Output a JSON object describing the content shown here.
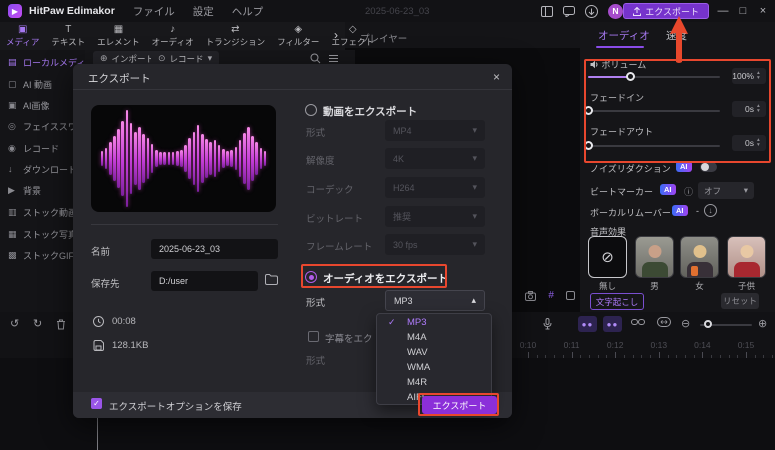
{
  "colors": {
    "accent": "#9a5cf0",
    "annotation": "#e8472e",
    "export_purple": "#8b2fd9",
    "waveform_pink": "#e85ad1"
  },
  "titlebar": {
    "app_name": "HitPaw Edimakor",
    "menus": [
      "ファイル",
      "設定",
      "ヘルプ"
    ],
    "project_name": "2025-06-23_03",
    "avatar": "N",
    "export_button": "エクスポート",
    "window": {
      "minimize": "—",
      "maximize": "□",
      "close": "×"
    }
  },
  "tabs": {
    "items": [
      {
        "label": "メディア",
        "icon": "▣"
      },
      {
        "label": "テキスト",
        "icon": "T"
      },
      {
        "label": "エレメント",
        "icon": "▦"
      },
      {
        "label": "オーディオ",
        "icon": "♪"
      },
      {
        "label": "トランジション",
        "icon": "⇄"
      },
      {
        "label": "フィルター",
        "icon": "◈"
      },
      {
        "label": "エフェクト",
        "icon": "◇"
      }
    ],
    "more": "›"
  },
  "player": {
    "label": "プレイヤー",
    "chevron": "⌄",
    "grid": "#"
  },
  "media_toolbar": {
    "import_icon": "⊕",
    "import": "インポート",
    "record_icon": "⊙",
    "record": "レコード",
    "dropdown": "▾"
  },
  "sidebar": {
    "items": [
      {
        "icon": "▤",
        "label": "ローカルメディア"
      },
      {
        "icon": "▢",
        "label": "AI 動画"
      },
      {
        "icon": "▣",
        "label": "AI画像"
      },
      {
        "icon": "◎",
        "label": "フェイススワップ"
      },
      {
        "icon": "◉",
        "label": "レコード"
      },
      {
        "icon": "↓",
        "label": "ダウンロード"
      },
      {
        "icon": "▶",
        "label": "背景"
      },
      {
        "icon": "▥",
        "label": "ストック動画"
      },
      {
        "icon": "▦",
        "label": "ストック写真"
      },
      {
        "icon": "▩",
        "label": "ストックGIF"
      }
    ]
  },
  "dialog": {
    "title": "エクスポート",
    "close": "×",
    "video_option": "動画をエクスポート",
    "video_rows": [
      {
        "label": "形式",
        "value": "MP4"
      },
      {
        "label": "解像度",
        "value": "4K"
      },
      {
        "label": "コーデック",
        "value": "H264"
      },
      {
        "label": "ビットレート",
        "value": "推奨"
      },
      {
        "label": "フレームレート",
        "value": "30 fps"
      }
    ],
    "name_label": "名前",
    "name_value": "2025-06-23_03",
    "dest_label": "保存先",
    "dest_value": "D:/user",
    "duration": "00:08",
    "filesize": "128.1KB",
    "audio_option": "オーディオをエクスポート",
    "audio_format_label": "形式",
    "audio_format_value": "MP3",
    "subtitle_option": "字幕をエクスポート",
    "subtitle_format_label": "形式",
    "format_dropdown": {
      "selected": "MP3",
      "check": "✓",
      "options": [
        "MP3",
        "M4A",
        "WAV",
        "WMA",
        "M4R",
        "AIFF"
      ]
    },
    "save_options": "エクスポートオプションを保存",
    "export_button": "エクスポート",
    "chevron_down": "▾",
    "chevron_up": "▴"
  },
  "right_panel": {
    "tabs": [
      "オーディオ",
      "速度"
    ],
    "volume": {
      "label": "ボリューム",
      "value": "100%",
      "slider_pct": 32
    },
    "fade_in": {
      "label": "フェードイン",
      "value": "0s",
      "slider_pct": 0
    },
    "fade_out": {
      "label": "フェードアウト",
      "value": "0s",
      "slider_pct": 0
    },
    "noise_reduction": {
      "label": "ノイズリダクション",
      "badge": "AI"
    },
    "beat_marker": {
      "label": "ビートマーカー",
      "badge": "AI",
      "info": "ⓘ",
      "value": "オフ",
      "dropdown": "▾"
    },
    "vocal_remover": {
      "label": "ボーカルリムーバー",
      "badge": "AI",
      "dash": "-",
      "download": "↓"
    },
    "voice_fx": {
      "label": "音声効果",
      "none_icon": "⊘",
      "items": [
        "無し",
        "男",
        "女",
        "子供"
      ]
    },
    "transcribe": "文字起こし",
    "reset": "リセット"
  },
  "timeline": {
    "undo": "↺",
    "redo": "↻",
    "zoom_out": "⊖",
    "zoom_in": "⊕",
    "ruler_labels": [
      "0:10",
      "0:11",
      "0:12",
      "0:13",
      "0:14",
      "0:15"
    ]
  },
  "waveform": {
    "bars": [
      14,
      20,
      30,
      42,
      56,
      70,
      90,
      66,
      50,
      58,
      46,
      38,
      28,
      16,
      13,
      12,
      12,
      13,
      14,
      16,
      26,
      38,
      50,
      62,
      46,
      36,
      30,
      34,
      26,
      18,
      14,
      15,
      22,
      34,
      47,
      58,
      42,
      30,
      20,
      14
    ]
  }
}
